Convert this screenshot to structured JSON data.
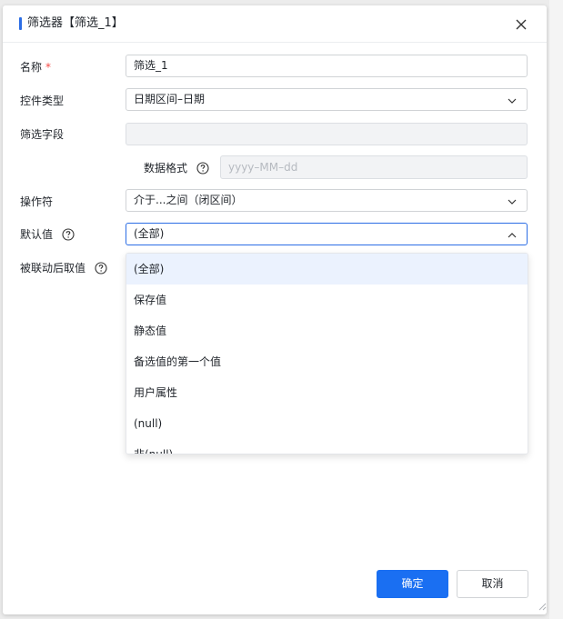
{
  "dialog": {
    "title": "筛选器【筛选_1】",
    "accent_color": "#2b6de5"
  },
  "form": {
    "name": {
      "label": "名称",
      "required_mark": "*",
      "value": "筛选_1"
    },
    "control_type": {
      "label": "控件类型",
      "value": "日期区间–日期"
    },
    "filter_field": {
      "label": "筛选字段",
      "value": ""
    },
    "data_format": {
      "label": "数据格式",
      "placeholder": "yyyy–MM–dd"
    },
    "operator": {
      "label": "操作符",
      "value": "介于...之间（闭区间）"
    },
    "default_value": {
      "label": "默认值",
      "value": "(全部)"
    },
    "linked_value": {
      "label": "被联动后取值"
    }
  },
  "dropdown": {
    "options": [
      {
        "label": "(全部)",
        "selected": true
      },
      {
        "label": "保存值"
      },
      {
        "label": "静态值"
      },
      {
        "label": "备选值的第一个值"
      },
      {
        "label": "用户属性"
      },
      {
        "label": "(null)"
      },
      {
        "label": "非(null)"
      }
    ]
  },
  "footer": {
    "confirm_label": "确定",
    "cancel_label": "取消",
    "primary_color": "#1a6ff2"
  },
  "icons": [
    "close-icon",
    "help-icon",
    "chevron-down-icon",
    "chevron-up-icon",
    "resize-grip-icon"
  ]
}
